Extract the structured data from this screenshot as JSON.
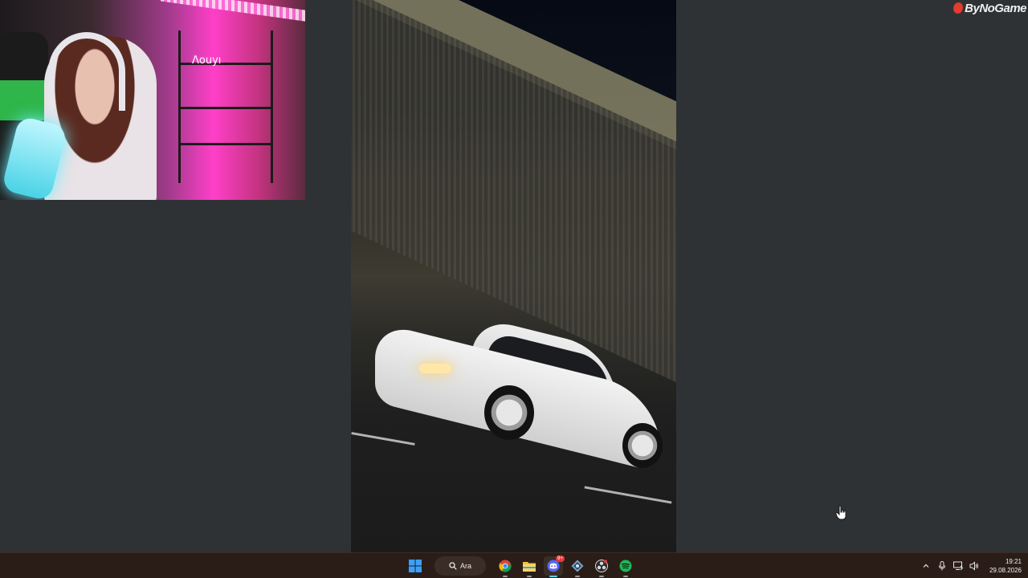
{
  "logo": {
    "text": "ByNoGame"
  },
  "webcam": {
    "neon_sign": "Λouyı"
  },
  "taskbar": {
    "search_label": "Ara",
    "pinned_apps": [
      {
        "icon": "windows-start-icon"
      },
      {
        "icon": "search-icon"
      },
      {
        "icon": "chrome-icon"
      },
      {
        "icon": "file-explorer-icon"
      },
      {
        "icon": "discord-icon",
        "badge": "9+",
        "active": true
      },
      {
        "icon": "vpn-app-icon"
      },
      {
        "icon": "obs-icon"
      },
      {
        "icon": "spotify-icon"
      }
    ],
    "tray": {
      "icons": [
        "chevron-up-icon",
        "microphone-icon",
        "monitor-network-icon",
        "speaker-icon"
      ],
      "time": "19:21",
      "date": "29.08.2026"
    }
  },
  "colors": {
    "desktop_bg": "#2f3235",
    "taskbar_bg": "#2a1d18",
    "logo_red": "#e33b2c",
    "spotify_green": "#1db954",
    "windows_blue": "#3aa0ff"
  }
}
